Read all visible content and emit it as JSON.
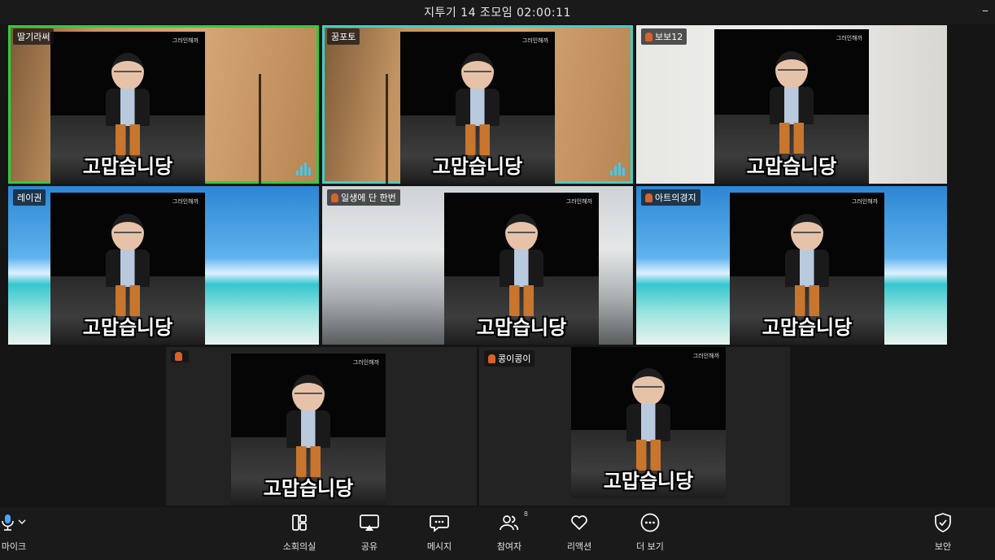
{
  "window": {
    "title": "지투기 14 조모임 02:00:11",
    "minimize": "–"
  },
  "video_text": {
    "watermark": "그러인해까",
    "caption": "고맙습니당"
  },
  "participants": [
    {
      "name": "딸기라써",
      "muted": false,
      "speaking": true,
      "border_color": "#2ecc40"
    },
    {
      "name": "꿈포토",
      "muted": false,
      "speaking": true,
      "border_color": "#3fd0c8"
    },
    {
      "name": "보보12",
      "muted": true,
      "speaking": false
    },
    {
      "name": "레이권",
      "muted": false,
      "speaking": false
    },
    {
      "name": "일생에 단 한번",
      "muted": true,
      "speaking": false
    },
    {
      "name": "아트의경지",
      "muted": true,
      "speaking": false
    },
    {
      "name": "",
      "muted": true,
      "speaking": false
    },
    {
      "name": "콩이콩이",
      "muted": true,
      "speaking": false
    }
  ],
  "toolbar": {
    "mic_label": "마이크",
    "breakout_label": "소회의실",
    "share_label": "공유",
    "chat_label": "메시지",
    "participants_label": "참여자",
    "participants_count": "8",
    "reactions_label": "리액션",
    "more_label": "더 보기",
    "security_label": "보안"
  },
  "icons": {
    "mic": "microphone-icon",
    "breakout": "breakout-rooms-icon",
    "share": "share-screen-icon",
    "chat": "chat-bubble-icon",
    "participants": "participants-icon",
    "reactions": "heart-icon",
    "more": "more-dots-icon",
    "security": "shield-check-icon"
  }
}
